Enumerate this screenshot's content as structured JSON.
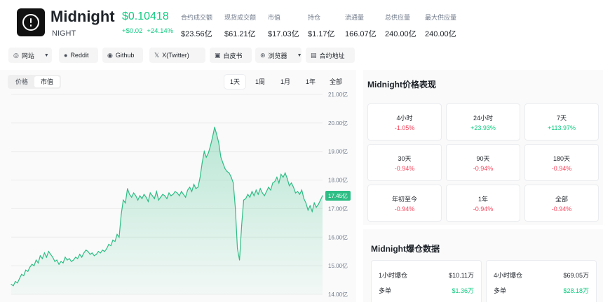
{
  "header": {
    "name": "Midnight",
    "symbol": "NIGHT",
    "price": "$0.10418",
    "change_abs": "+$0.02",
    "change_pct": "+24.14%",
    "stats": [
      {
        "label": "合约成交额",
        "value": "$23.56亿"
      },
      {
        "label": "现货成交额",
        "value": "$61.21亿"
      },
      {
        "label": "市值",
        "value": "$17.03亿"
      },
      {
        "label": "持仓",
        "value": "$1.17亿"
      },
      {
        "label": "流通量",
        "value": "166.07亿"
      },
      {
        "label": "总供应量",
        "value": "240.00亿"
      },
      {
        "label": "最大供应量",
        "value": "240.00亿"
      }
    ]
  },
  "links": [
    {
      "label": "网站",
      "icon": "globe-icon",
      "glyph": "◎",
      "has_dropdown": true
    },
    {
      "label": "Reddit",
      "icon": "reddit-icon",
      "glyph": "●",
      "has_dropdown": false
    },
    {
      "label": "Github",
      "icon": "github-icon",
      "glyph": "◉",
      "has_dropdown": false
    },
    {
      "label": "X(Twitter)",
      "icon": "x-icon",
      "glyph": "𝕏",
      "has_dropdown": false
    },
    {
      "label": "白皮书",
      "icon": "document-icon",
      "glyph": "▣",
      "has_dropdown": false
    },
    {
      "label": "浏览器",
      "icon": "explorer-icon",
      "glyph": "⊛",
      "has_dropdown": true
    },
    {
      "label": "合约地址",
      "icon": "contract-icon",
      "glyph": "▤",
      "has_dropdown": false
    }
  ],
  "chart_controls": {
    "views": [
      "价格",
      "市值"
    ],
    "active_view": "市值",
    "ranges": [
      "1天",
      "1周",
      "1月",
      "1年",
      "全部"
    ],
    "active_range": "1天"
  },
  "chart_data": {
    "type": "area",
    "x": [
      0,
      1,
      2,
      3,
      4,
      5,
      6,
      7,
      8,
      9,
      10,
      11,
      12,
      13,
      14,
      15,
      16,
      17,
      18,
      19,
      20,
      21,
      22,
      23,
      24,
      25,
      26,
      27,
      28,
      29,
      30,
      31,
      32,
      33,
      34,
      35,
      36,
      37,
      38,
      39,
      40,
      41,
      42,
      43,
      44,
      45,
      46,
      47,
      48,
      49,
      50,
      51,
      52,
      53,
      54,
      55,
      56,
      57,
      58,
      59,
      60,
      61,
      62,
      63,
      64,
      65,
      66,
      67,
      68,
      69,
      70,
      71,
      72,
      73,
      74,
      75,
      76,
      77,
      78,
      79,
      80,
      81,
      82,
      83,
      84,
      85,
      86,
      87,
      88,
      89,
      90,
      91,
      92,
      93,
      94,
      95,
      96,
      97,
      98,
      99,
      100,
      101,
      102,
      103,
      104,
      105,
      106,
      107,
      108,
      109,
      110,
      111,
      112,
      113,
      114,
      115,
      116,
      117,
      118,
      119,
      120,
      121,
      122,
      123,
      124,
      125,
      126,
      127,
      128,
      129,
      130,
      131,
      132,
      133,
      134,
      135,
      136,
      137,
      138,
      139,
      140,
      141,
      142,
      143,
      144,
      145,
      146,
      147,
      148,
      149,
      150
    ],
    "values": [
      14.35,
      14.3,
      14.45,
      14.4,
      14.55,
      14.7,
      14.65,
      14.85,
      14.8,
      14.95,
      15.05,
      15.0,
      15.2,
      15.1,
      15.35,
      15.25,
      15.45,
      15.3,
      15.5,
      15.4,
      15.3,
      15.15,
      15.2,
      15.05,
      15.15,
      15.1,
      15.3,
      15.2,
      15.25,
      15.15,
      15.2,
      15.3,
      15.25,
      15.4,
      15.3,
      15.45,
      15.55,
      15.5,
      15.4,
      15.45,
      15.35,
      15.4,
      15.5,
      15.45,
      15.55,
      15.5,
      15.6,
      15.75,
      15.7,
      15.9,
      15.85,
      16.1,
      16.0,
      16.8,
      17.3,
      17.2,
      17.7,
      17.5,
      17.4,
      17.55,
      17.45,
      17.3,
      17.45,
      17.35,
      17.5,
      17.4,
      17.25,
      17.55,
      17.45,
      17.35,
      17.6,
      17.3,
      17.4,
      17.5,
      17.45,
      17.35,
      17.55,
      17.45,
      17.5,
      17.6,
      17.55,
      17.45,
      17.6,
      17.5,
      17.4,
      17.65,
      17.75,
      17.6,
      17.85,
      17.7,
      17.75,
      18.1,
      18.6,
      19.0,
      18.8,
      18.95,
      19.2,
      19.5,
      19.85,
      19.6,
      19.3,
      18.8,
      18.6,
      18.4,
      18.3,
      18.25,
      18.1,
      17.9,
      17.0,
      15.6,
      15.2,
      16.4,
      17.3,
      17.35,
      17.5,
      17.4,
      17.6,
      17.45,
      17.65,
      17.5,
      17.7,
      17.55,
      17.45,
      17.6,
      17.75,
      17.65,
      17.9,
      17.95,
      18.1,
      17.9,
      18.2,
      18.1,
      18.25,
      18.05,
      17.8,
      17.9,
      17.75,
      17.55,
      17.6,
      17.5,
      17.65,
      17.35,
      17.2,
      16.95,
      17.1,
      16.9,
      17.2,
      17.05,
      17.15,
      17.3,
      17.45
    ],
    "ylim": [
      14.0,
      21.0
    ],
    "y_ticks": [
      "21.00亿",
      "20.00亿",
      "19.00亿",
      "18.00亿",
      "17.00亿",
      "16.00亿",
      "15.00亿",
      "14.00亿"
    ],
    "y_tick_values": [
      21,
      20,
      19,
      18,
      17,
      16,
      15,
      14
    ],
    "current_label": "17.45亿",
    "current_value": 17.45,
    "line_color": "#2ebd85",
    "grid": true
  },
  "performance": {
    "title": "Midnight价格表现",
    "items": [
      {
        "label": "4小时",
        "value": "-1.05%",
        "dir": "neg"
      },
      {
        "label": "24小时",
        "value": "+23.93%",
        "dir": "pos"
      },
      {
        "label": "7天",
        "value": "+113.97%",
        "dir": "pos"
      },
      {
        "label": "30天",
        "value": "-0.94%",
        "dir": "neg"
      },
      {
        "label": "90天",
        "value": "-0.94%",
        "dir": "neg"
      },
      {
        "label": "180天",
        "value": "-0.94%",
        "dir": "neg"
      },
      {
        "label": "年初至今",
        "value": "-0.94%",
        "dir": "neg"
      },
      {
        "label": "1年",
        "value": "-0.94%",
        "dir": "neg"
      },
      {
        "label": "全部",
        "value": "-0.94%",
        "dir": "neg"
      }
    ]
  },
  "liquidation": {
    "title": "Midnight爆仓数据",
    "boxes": [
      {
        "rows": [
          {
            "label": "1小时爆仓",
            "value": "$10.11万"
          },
          {
            "label": "多单",
            "value": "$1.36万"
          }
        ]
      },
      {
        "rows": [
          {
            "label": "4小时爆仓",
            "value": "$69.05万"
          },
          {
            "label": "多单",
            "value": "$28.18万"
          }
        ]
      }
    ]
  },
  "colors": {
    "positive": "#0ecb81",
    "negative": "#f6465d",
    "accent_fill": "#c7f0dd"
  }
}
